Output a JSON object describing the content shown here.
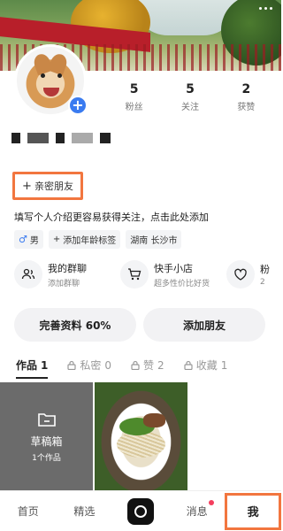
{
  "stats": [
    {
      "num": "5",
      "label": "粉丝"
    },
    {
      "num": "5",
      "label": "关注"
    },
    {
      "num": "2",
      "label": "获赞"
    }
  ],
  "intimate_button": "亲密朋友",
  "bio": "填写个人介绍更容易获得关注，点击此处添加",
  "tags": {
    "gender": "男",
    "age": "添加年龄标签",
    "location": "湖南 长沙市"
  },
  "features": [
    {
      "title": "我的群聊",
      "sub": "添加群聊",
      "icon": "group-icon"
    },
    {
      "title": "快手小店",
      "sub": "超多性价比好货",
      "icon": "cart-icon"
    },
    {
      "title": "粉",
      "sub": "2",
      "icon": "heart-icon"
    }
  ],
  "actions": {
    "complete_profile": "完善资料 60%",
    "add_friend": "添加朋友"
  },
  "tabs": [
    {
      "label": "作品",
      "count": "1"
    },
    {
      "label": "私密",
      "count": "0"
    },
    {
      "label": "赞",
      "count": "2"
    },
    {
      "label": "收藏",
      "count": "1"
    }
  ],
  "draft": {
    "title": "草稿箱",
    "sub": "1个作品"
  },
  "nav": {
    "home": "首页",
    "featured": "精选",
    "messages": "消息",
    "me": "我"
  }
}
